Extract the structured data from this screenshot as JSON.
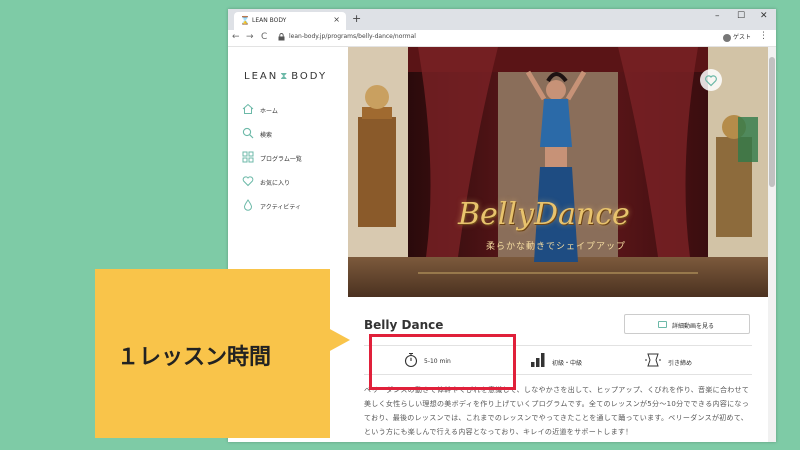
{
  "browser": {
    "tab_title": "LEAN BODY",
    "tab_close": "×",
    "new_tab": "+",
    "url": "lean-body.jp/programs/belly-dance/normal",
    "profile_label": "ゲスト",
    "nav": {
      "back": "←",
      "forward": "→",
      "reload": "C"
    },
    "window_controls": {
      "minimize": "–",
      "maximize": "☐",
      "close": "✕"
    },
    "menu": "⋮"
  },
  "site": {
    "logo_left": "LEAN",
    "logo_right": "BODY",
    "sidebar": {
      "items": [
        {
          "label": "ホーム",
          "icon": "home-icon"
        },
        {
          "label": "検索",
          "icon": "search-icon"
        },
        {
          "label": "プログラム一覧",
          "icon": "grid-icon"
        },
        {
          "label": "お気に入り",
          "icon": "heart-icon"
        },
        {
          "label": "アクティビティ",
          "icon": "drop-icon"
        }
      ]
    },
    "hero": {
      "title": "BellyDance",
      "subtitle": "柔らかな動きでシェイプアップ"
    },
    "program": {
      "title": "Belly Dance",
      "detail_button": "詳細動画を見る",
      "duration": "5-10 min",
      "level": "初級・中級",
      "category": "引き締め",
      "description": "ベリーダンスの動きで体幹やくびれを意識して、しなやかさを出して、ヒップアップ、くびれを作り、音楽に合わせて美しく女性らしい理想の美ボディを作り上げていくプログラムです。全てのレッスンが5分〜10分でできる内容になっており、最後のレッスンでは、これまでのレッスンでやってきたことを通して踊っています。ベリーダンスが初めて、という方にも楽しんで行える内容となっており、キレイの近道をサポートします！"
    }
  },
  "callout": {
    "text": "１レッスン時間"
  },
  "colors": {
    "background": "#7ecba6",
    "accent": "#6cb9a8",
    "highlight": "#e0203a",
    "callout": "#f9c44a"
  }
}
